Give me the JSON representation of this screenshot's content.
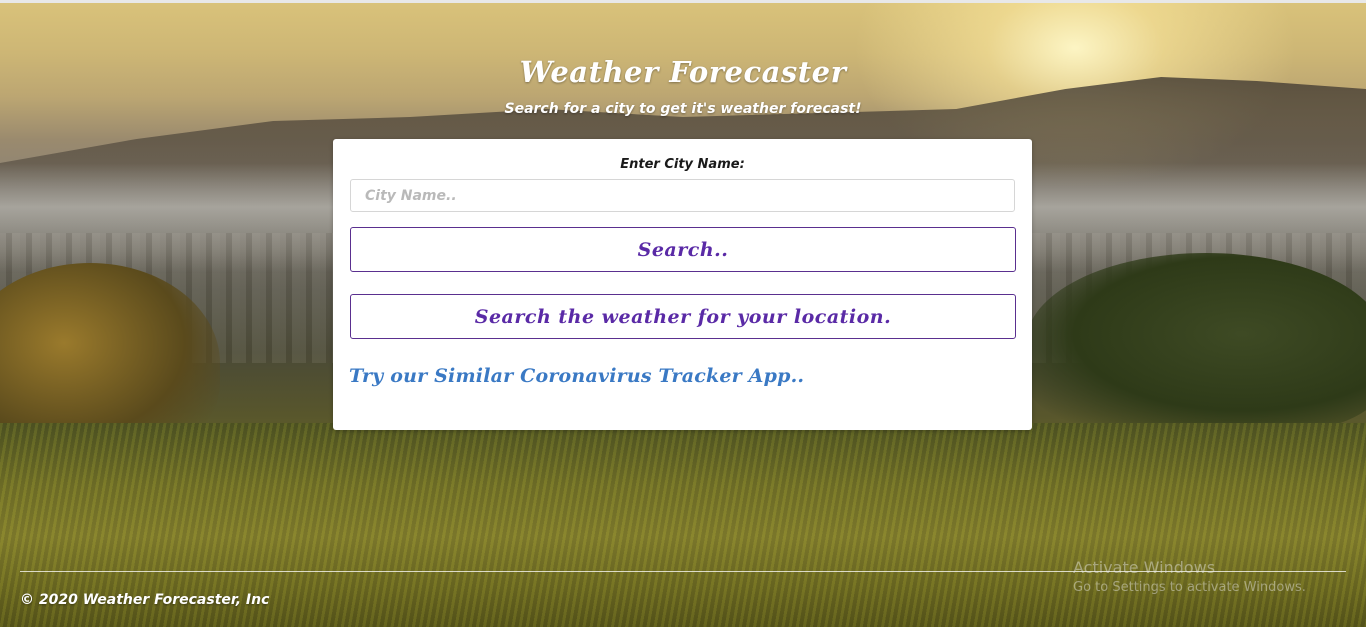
{
  "header": {
    "title": "Weather Forecaster",
    "subtitle": "Search for a city to get it's weather forecast!"
  },
  "search_card": {
    "label": "Enter City Name:",
    "city_input": {
      "value": "",
      "placeholder": "City Name.."
    },
    "search_button_label": "Search..",
    "location_button_label": "Search the weather for your location.",
    "tracker_link_label": "Try our Similar Coronavirus Tracker App.."
  },
  "footer": {
    "copyright": "© 2020 Weather Forecaster, Inc"
  },
  "watermark": {
    "title": "Activate Windows",
    "subtitle": "Go to Settings to activate Windows."
  },
  "colors": {
    "button_border": "#5a2f8f",
    "button_text": "#5a2aa6",
    "link_text": "#3a79c4",
    "card_bg": "#ffffff"
  }
}
